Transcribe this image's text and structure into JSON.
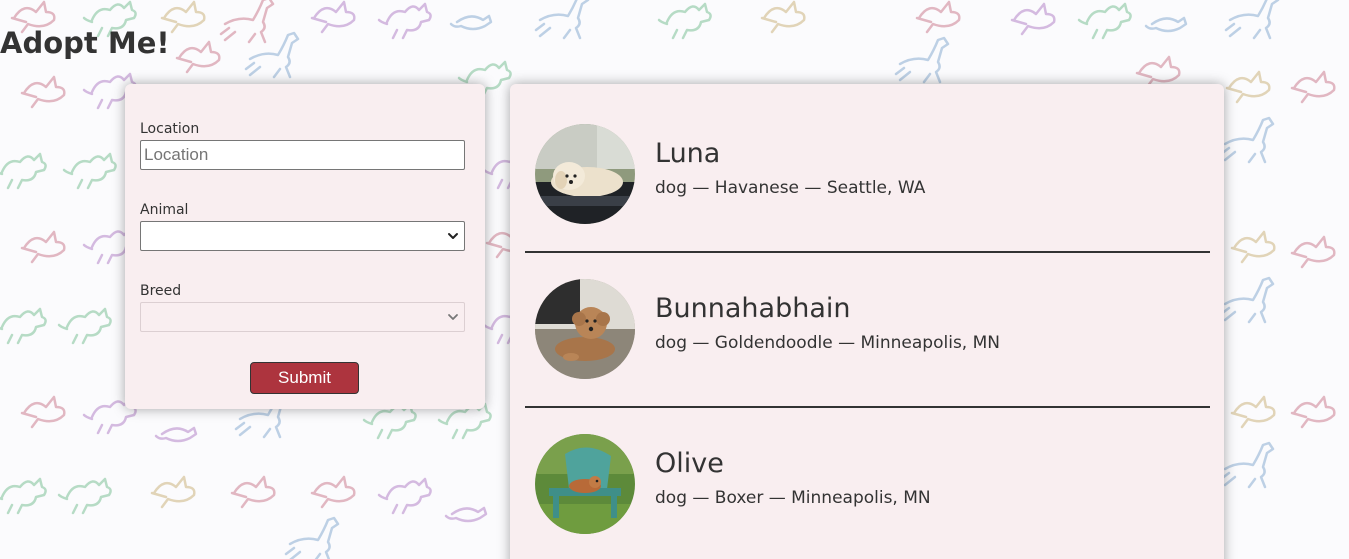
{
  "app": {
    "title": "Adopt Me!"
  },
  "search": {
    "location_label": "Location",
    "location_placeholder": "Location",
    "location_value": "",
    "animal_label": "Animal",
    "animal_selected": "",
    "breed_label": "Breed",
    "breed_selected": "",
    "breed_disabled": true,
    "submit_label": "Submit"
  },
  "pets": [
    {
      "name": "Luna",
      "animal": "dog",
      "breed": "Havanese",
      "location": "Seattle, WA",
      "description": "dog — Havanese — Seattle, WA"
    },
    {
      "name": "Bunnahabhain",
      "animal": "dog",
      "breed": "Goldendoodle",
      "location": "Minneapolis, MN",
      "description": "dog — Goldendoodle — Minneapolis, MN"
    },
    {
      "name": "Olive",
      "animal": "dog",
      "breed": "Boxer",
      "location": "Minneapolis, MN",
      "description": "dog — Boxer — Minneapolis, MN"
    }
  ],
  "icons": {
    "select_chevron": "chevron-down-icon",
    "background_pattern": "animal-doodle-pattern"
  },
  "colors": {
    "card_background": "#f9eef0",
    "submit_background": "#ad343e",
    "text": "#333333",
    "pattern_strokes": [
      "#c7a5d6",
      "#9fd1b2",
      "#a9c2dc",
      "#d9a1ae",
      "#d8c7a0"
    ]
  }
}
